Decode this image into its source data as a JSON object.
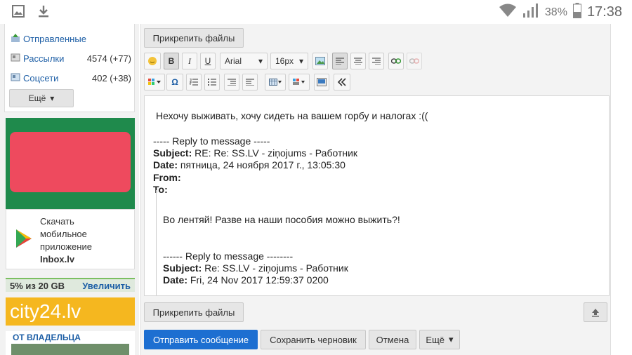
{
  "status_bar": {
    "battery_pct": "38%",
    "clock": "17:38",
    "icons": [
      "image-icon",
      "download-icon",
      "wifi-icon",
      "signal-icon",
      "battery-icon"
    ]
  },
  "sidebar": {
    "items": [
      {
        "label": "Отправленные",
        "count": "",
        "icon": "sent-icon"
      },
      {
        "label": "Рассылки",
        "count": "4574 (+77)",
        "icon": "newsletter-icon"
      },
      {
        "label": "Соцсети",
        "count": "402 (+38)",
        "icon": "social-icon"
      }
    ],
    "more_label": "Ещё"
  },
  "app_promo": {
    "line1": "Скачать",
    "line2": "мобильное",
    "line3": "приложение",
    "line4": "Inbox.lv"
  },
  "storage": {
    "used_text": "5% из 20 GB",
    "used_fraction": 0.05,
    "upgrade_label": "Увеличить"
  },
  "ads": {
    "city24_text": "city24.lv",
    "owner_title": "ОТ ВЛАДЕЛЬЦА"
  },
  "editor": {
    "attach_top_label": "Прикрепить файлы",
    "attach_bottom_label": "Прикрепить файлы",
    "font_family": "Arial",
    "font_size": "16px",
    "bold_label": "B",
    "italic_label": "I",
    "underline_label": "U",
    "body": {
      "reply_line": "Нехочу выживать, хочу сидеть на вашем горбу и налогах :((",
      "sep1": "----- Reply to message -----",
      "subject_label": "Subject:",
      "subject_value": " RE: Re: SS.LV - ziņojums - Работник",
      "date_label": "Date:",
      "date_value": " пятница, 24 ноября 2017 г., 13:05:30",
      "from_label": "From:",
      "to_label": "To:",
      "quote_line": "Во лентяй! Разве на наши пособия можно выжить?!",
      "sep2": "------ Reply to message --------",
      "subject2_label": "Subject:",
      "subject2_value": " Re: SS.LV - ziņojums - Работник",
      "date2_label": "Date:",
      "date2_value": " Fri, 24 Nov 2017 12:59:37 0200"
    },
    "actions": {
      "send": "Отправить сообщение",
      "save_draft": "Сохранить черновик",
      "cancel": "Отмена",
      "more": "Ещё"
    }
  },
  "colors": {
    "accent": "#1d6fd1",
    "link": "#1e5fa6",
    "storage_bar": "#7bbf61",
    "city24": "#f5b71f"
  }
}
